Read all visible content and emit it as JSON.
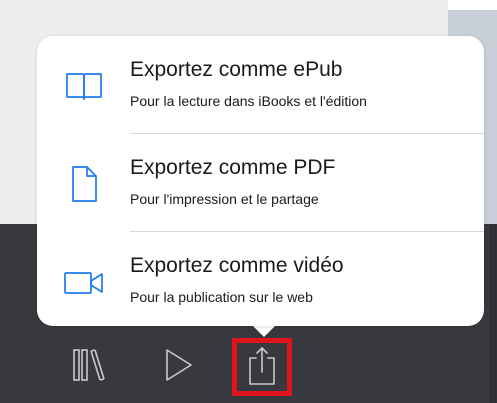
{
  "export_menu": {
    "items": [
      {
        "id": "epub",
        "icon": "book-icon",
        "title": "Exportez comme ePub",
        "subtitle": "Pour la lecture dans iBooks et l'édition"
      },
      {
        "id": "pdf",
        "icon": "document-icon",
        "title": "Exportez comme PDF",
        "subtitle": "Pour l'impression et le partage"
      },
      {
        "id": "video",
        "icon": "video-camera-icon",
        "title": "Exportez comme vidéo",
        "subtitle": "Pour la publication sur le web"
      }
    ]
  },
  "toolbar": {
    "buttons": [
      {
        "icon": "library-icon"
      },
      {
        "icon": "play-icon"
      },
      {
        "icon": "share-icon",
        "highlighted": true
      }
    ]
  },
  "colors": {
    "accent": "#1d7bf0",
    "toolbar_bg": "#37393f",
    "toolbar_icon": "#c8c9cc",
    "highlight": "#e0141c",
    "popover_bg": "#ffffff"
  }
}
